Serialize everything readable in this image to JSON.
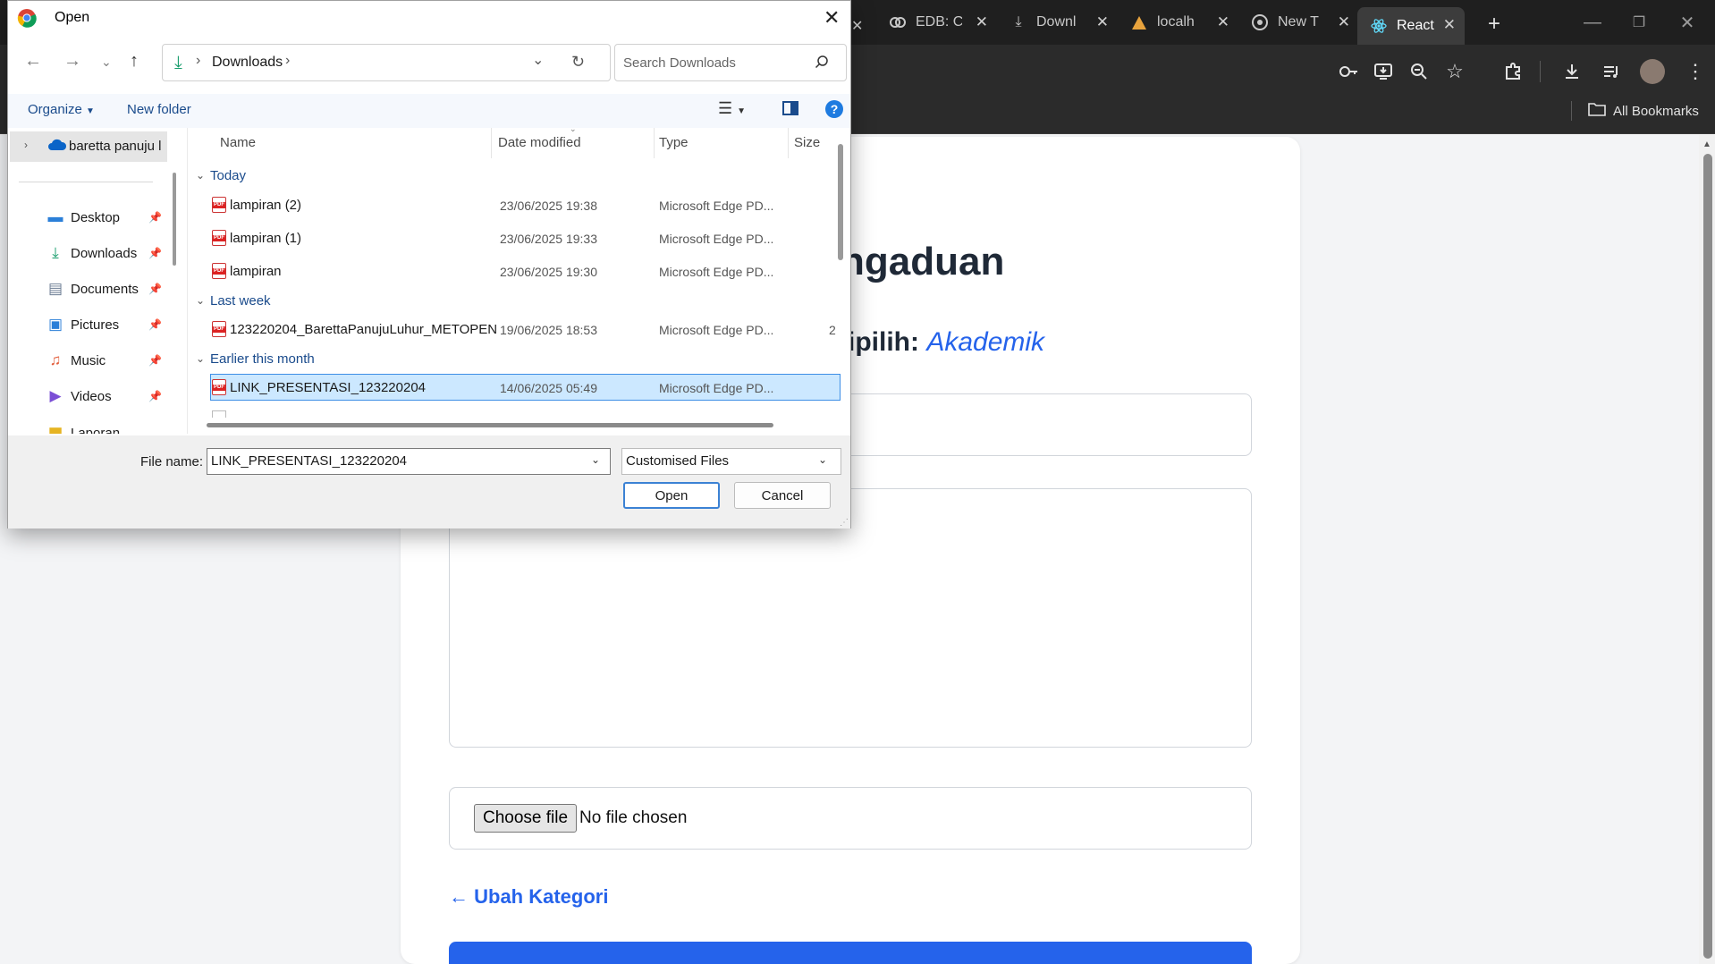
{
  "browser": {
    "tabs": [
      {
        "label": "EDB: C",
        "icon": "edb-icon"
      },
      {
        "label": "Downl",
        "icon": "download-icon"
      },
      {
        "label": "localh",
        "icon": "localhost-icon"
      },
      {
        "label": "New T",
        "icon": "chrome-icon"
      },
      {
        "label": "React",
        "icon": "react-icon",
        "active": true
      }
    ],
    "new_tab": "+",
    "bookmarks_label": "All Bookmarks"
  },
  "page": {
    "title_fragment": "ngaduan",
    "category_prefix": "ipilih: ",
    "category_value": "Akademik",
    "choose_file": "Choose file",
    "no_file": "No file chosen",
    "back_link": "← Ubah Kategori"
  },
  "dialog": {
    "title": "Open",
    "address": {
      "path": "Downloads",
      "separator": "›"
    },
    "search_placeholder": "Search Downloads",
    "commands": {
      "organize": "Organize",
      "new_folder": "New folder"
    },
    "nav": {
      "top_item": "baretta panuju l",
      "items": [
        {
          "label": "Desktop",
          "icon": "desktop-icon"
        },
        {
          "label": "Downloads",
          "icon": "download-icon"
        },
        {
          "label": "Documents",
          "icon": "document-icon"
        },
        {
          "label": "Pictures",
          "icon": "pictures-icon"
        },
        {
          "label": "Music",
          "icon": "music-icon"
        },
        {
          "label": "Videos",
          "icon": "videos-icon"
        },
        {
          "label": "Laporan",
          "icon": "folder-icon"
        }
      ]
    },
    "columns": [
      "Name",
      "Date modified",
      "Type",
      "Size"
    ],
    "groups": [
      {
        "name": "Today",
        "files": [
          {
            "name": "lampiran (2)",
            "date": "23/06/2025 19:38",
            "type": "Microsoft Edge PD..."
          },
          {
            "name": "lampiran (1)",
            "date": "23/06/2025 19:33",
            "type": "Microsoft Edge PD..."
          },
          {
            "name": "lampiran",
            "date": "23/06/2025 19:30",
            "type": "Microsoft Edge PD..."
          }
        ]
      },
      {
        "name": "Last week",
        "files": [
          {
            "name": "123220204_BarettaPanujuLuhur_METOPEN",
            "date": "19/06/2025 18:53",
            "type": "Microsoft Edge PD...",
            "size": "2"
          }
        ]
      },
      {
        "name": "Earlier this month",
        "files": [
          {
            "name": "LINK_PRESENTASI_123220204",
            "date": "14/06/2025 05:49",
            "type": "Microsoft Edge PD...",
            "selected": true
          }
        ]
      }
    ],
    "file_name_label": "File name:",
    "file_name_value": "LINK_PRESENTASI_123220204",
    "file_type": "Customised Files",
    "open_button": "Open",
    "cancel_button": "Cancel"
  }
}
